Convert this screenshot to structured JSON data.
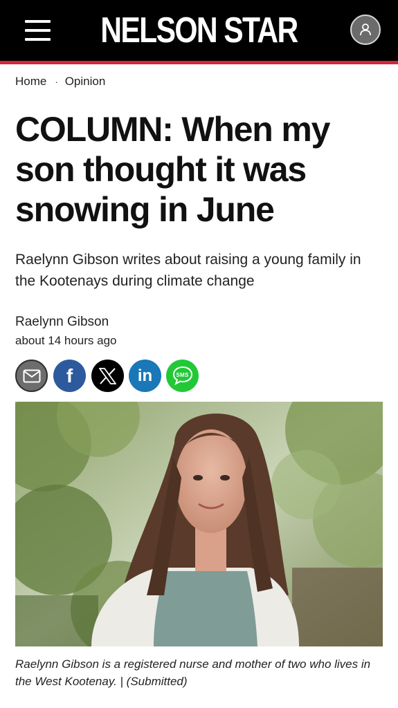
{
  "header": {
    "logo_text": "NELSON STAR",
    "menu_icon": "hamburger-menu-icon",
    "account_icon": "user-icon",
    "background": "#000000",
    "accent": "#d4273a"
  },
  "breadcrumb": {
    "home": "Home",
    "separator": "·",
    "section": "Opinion"
  },
  "article": {
    "headline": "COLUMN: When my son thought it was snowing in June",
    "subheadline": "Raelynn Gibson writes about raising a young family in the Kootenays during climate change",
    "author": "Raelynn Gibson",
    "published": "about 14 hours ago"
  },
  "share": [
    {
      "name": "email",
      "icon": "envelope-icon",
      "color": "#6d6d6d"
    },
    {
      "name": "facebook",
      "icon": "facebook-icon",
      "label": "f",
      "color": "#2c5a9d"
    },
    {
      "name": "x",
      "icon": "x-icon",
      "color": "#000000"
    },
    {
      "name": "linkedin",
      "icon": "linkedin-icon",
      "label": "in",
      "color": "#1a77b8"
    },
    {
      "name": "sms",
      "icon": "sms-icon",
      "label": "SMS",
      "color": "#22c937"
    }
  ],
  "photo": {
    "subject": "woman-portrait"
  },
  "caption": "Raelynn Gibson is a registered nurse and mother of two who lives in the West Kootenay.  |  (Submitted)"
}
